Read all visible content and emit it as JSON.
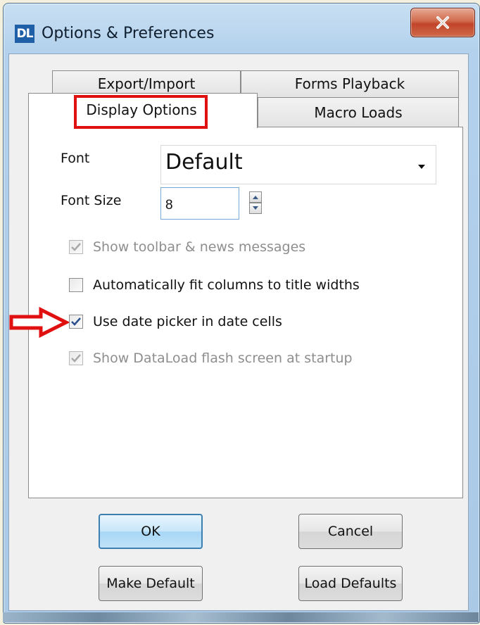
{
  "window": {
    "title": "Options & Preferences",
    "app_logo": "DL",
    "close_icon": "close-icon"
  },
  "tabs": {
    "back_row": [
      "Export/Import",
      "Forms Playback"
    ],
    "front_row": [
      "Display Options",
      "Macro Loads"
    ],
    "selected": "Display Options"
  },
  "display_options": {
    "font_label": "Font",
    "font_value": "Default",
    "font_size_label": "Font Size",
    "font_size_value": "8",
    "options": [
      {
        "label": "Show toolbar & news messages",
        "checked": true,
        "disabled": true
      },
      {
        "label": "Automatically fit columns to title widths",
        "checked": false,
        "disabled": false
      },
      {
        "label": "Use date picker in date cells",
        "checked": true,
        "disabled": false
      },
      {
        "label": "Show DataLoad flash screen at startup",
        "checked": true,
        "disabled": true
      }
    ]
  },
  "buttons": {
    "ok": "OK",
    "cancel": "Cancel",
    "make_default": "Make Default",
    "load_defaults": "Load Defaults"
  },
  "colors": {
    "highlight": "#e01010",
    "check_enabled": "#2a4f8f",
    "check_disabled": "#a8a8a8"
  }
}
